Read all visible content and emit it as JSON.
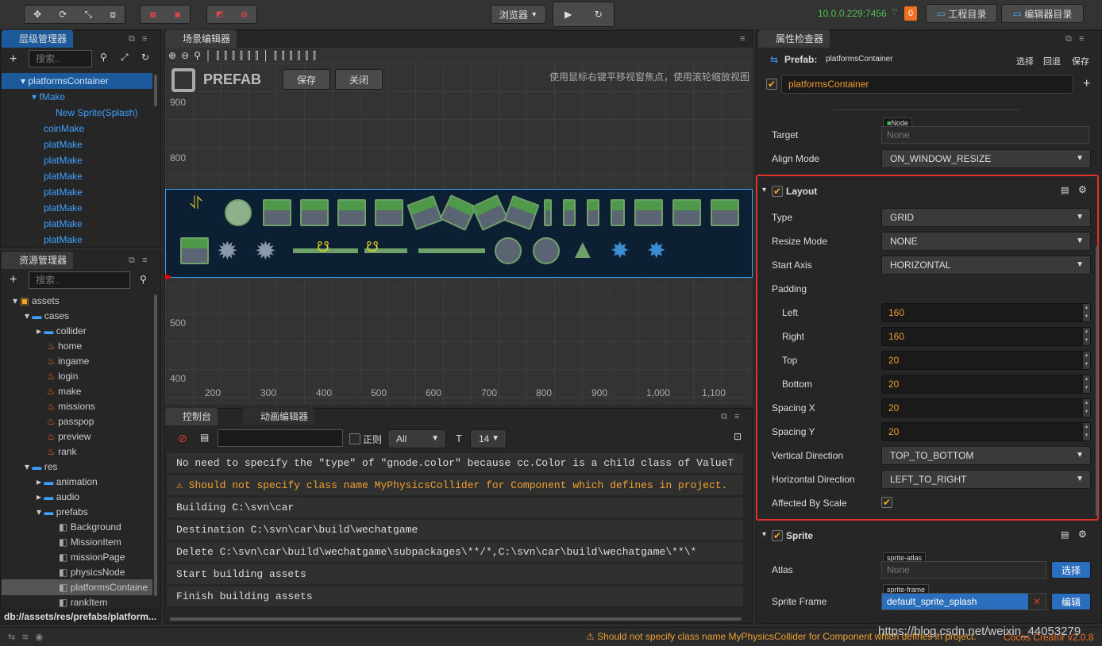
{
  "toolbar": {
    "browser_label": "浏览器",
    "ip": "10.0.0.229:7456",
    "badge": "0",
    "project_dir": "工程目录",
    "editor_dir": "编辑器目录"
  },
  "hierarchy": {
    "title": "层级管理器",
    "search_placeholder": "搜索..",
    "items": [
      "platformsContainer",
      "fMake",
      "New Sprite(Splash)",
      "coinMake",
      "platMake",
      "platMake",
      "platMake",
      "platMake",
      "platMake",
      "platMake",
      "platMake"
    ]
  },
  "assets": {
    "title": "资源管理器",
    "search_placeholder": "搜索..",
    "items": [
      "assets",
      "cases",
      "collider",
      "home",
      "ingame",
      "login",
      "make",
      "missions",
      "passpop",
      "preview",
      "rank",
      "res",
      "animation",
      "audio",
      "prefabs",
      "Background",
      "MissionItem",
      "missionPage",
      "physicsNode",
      "platformsContaine",
      "rankItem"
    ],
    "path": "db://assets/res/prefabs/platform..."
  },
  "scene": {
    "title": "场景编辑器",
    "prefab_label": "PREFAB",
    "save": "保存",
    "close": "关闭",
    "hint": "使用鼠标右键平移视窗焦点，使用滚轮缩放视图",
    "y_ticks": [
      "900",
      "800",
      "500",
      "400"
    ],
    "x_ticks": [
      "200",
      "300",
      "400",
      "500",
      "600",
      "700",
      "800",
      "900",
      "1,000",
      "1,100"
    ]
  },
  "console": {
    "title": "控制台",
    "anim_title": "动画编辑器",
    "regex_label": "正则",
    "filter_value": "All",
    "font_size": "14",
    "lines": [
      "No need to specify the \"type\" of \"gnode.color\" because cc.Color is a child class of ValueT",
      "Should not specify class name MyPhysicsCollider for Component which defines in project.",
      "Building C:\\svn\\car",
      "Destination C:\\svn\\car\\build\\wechatgame",
      "Delete C:\\svn\\car\\build\\wechatgame\\subpackages\\**/*,C:\\svn\\car\\build\\wechatgame\\**\\*",
      "Start building assets",
      "Finish building assets"
    ]
  },
  "inspector": {
    "title": "属性检查器",
    "prefab_label": "Prefab:",
    "prefab_name": "platformsContainer",
    "select": "选择",
    "revert": "回退",
    "save": "保存",
    "node_name": "platformsContainer",
    "target_label": "Target",
    "target_tag": "Node",
    "target_value": "None",
    "align_mode_label": "Align Mode",
    "align_mode_value": "ON_WINDOW_RESIZE",
    "layout": {
      "title": "Layout",
      "type_label": "Type",
      "type_value": "GRID",
      "resize_label": "Resize Mode",
      "resize_value": "NONE",
      "start_axis_label": "Start Axis",
      "start_axis_value": "HORIZONTAL",
      "padding_label": "Padding",
      "left_label": "Left",
      "left_value": "160",
      "right_label": "Right",
      "right_value": "160",
      "top_label": "Top",
      "top_value": "20",
      "bottom_label": "Bottom",
      "bottom_value": "20",
      "spacing_x_label": "Spacing X",
      "spacing_x_value": "20",
      "spacing_y_label": "Spacing Y",
      "spacing_y_value": "20",
      "vdir_label": "Vertical Direction",
      "vdir_value": "TOP_TO_BOTTOM",
      "hdir_label": "Horizontal Direction",
      "hdir_value": "LEFT_TO_RIGHT",
      "affected_label": "Affected By Scale"
    },
    "sprite": {
      "title": "Sprite",
      "atlas_label": "Atlas",
      "atlas_tag": "sprite-atlas",
      "atlas_value": "None",
      "atlas_btn": "选择",
      "frame_label": "Sprite Frame",
      "frame_tag": "sprite-frame",
      "frame_value": "default_sprite_splash",
      "frame_btn": "编辑"
    }
  },
  "status": {
    "warning": "Should not specify class name MyPhysicsCollider for Component which defines in project.",
    "watermark": "https://blog.csdn.net/weixin_44053279",
    "version": "Cocos Creator v2.0.8"
  },
  "colors": {
    "accent": "#3ea1ff",
    "warning": "#f0a030",
    "highlight_border": "#e0302a"
  }
}
